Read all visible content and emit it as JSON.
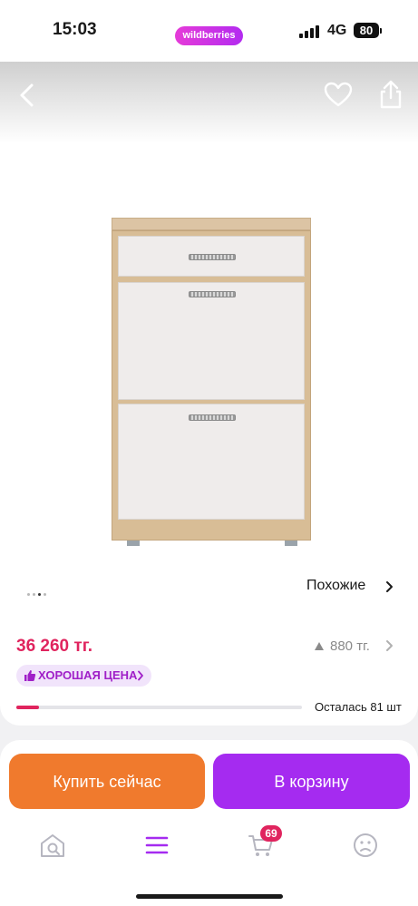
{
  "status_bar": {
    "time": "15:03",
    "app_badge": "wildberries",
    "network": "4G",
    "battery": "80"
  },
  "gallery": {
    "similar_label": "Похожие",
    "image_count": 4,
    "active_index": 2
  },
  "price": {
    "current": "36 260 тг.",
    "change": "880 тг.",
    "badge": "ХОРОШАЯ ЦЕНА",
    "stock_label": "Осталась 81 шт",
    "stock_fraction": 0.08
  },
  "actions": {
    "buy_now": "Купить сейчас",
    "add_to_cart": "В корзину"
  },
  "tabbar": {
    "cart_count": "69"
  },
  "colors": {
    "brand_purple": "#a52bf0",
    "buy_orange": "#f07a2d",
    "price_pink": "#e0245e"
  }
}
